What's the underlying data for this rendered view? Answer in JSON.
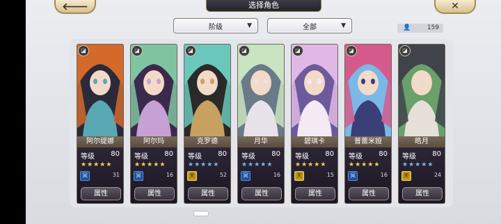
{
  "header": {
    "title": "选择角色",
    "back_icon": "back-arrow-icon",
    "close_icon": "close-icon"
  },
  "filters": {
    "rank_label": "阶级",
    "all_label": "全部"
  },
  "count": {
    "value": "159"
  },
  "card_common": {
    "level_label": "等级",
    "attribute_label": "属性"
  },
  "characters": [
    {
      "name": "阿尔缇娜",
      "level": "80",
      "stars": 5,
      "star_color": "gold",
      "class_icon": "冥",
      "class_color": "blue",
      "count": "31"
    },
    {
      "name": "阿尔玛",
      "level": "80",
      "stars": 5,
      "star_color": "gold",
      "class_icon": "冥",
      "class_color": "blue",
      "count": "16"
    },
    {
      "name": "克罗德",
      "level": "80",
      "stars": 5,
      "star_color": "blue",
      "class_icon": "天",
      "class_color": "gold",
      "count": "52"
    },
    {
      "name": "月华",
      "level": "80",
      "stars": 5,
      "star_color": "blue",
      "class_icon": "冥",
      "class_color": "blue",
      "count": "16"
    },
    {
      "name": "碧琪卡",
      "level": "80",
      "stars": 5,
      "star_color": "gold",
      "class_icon": "天",
      "class_color": "gold",
      "count": "15"
    },
    {
      "name": "普蕾米娅",
      "level": "80",
      "stars": 5,
      "star_color": "gold",
      "class_icon": "冥",
      "class_color": "blue",
      "count": "16"
    },
    {
      "name": "皓月",
      "level": "80",
      "stars": 5,
      "star_color": "blue",
      "class_icon": "天",
      "class_color": "gold",
      "count": "24"
    }
  ]
}
